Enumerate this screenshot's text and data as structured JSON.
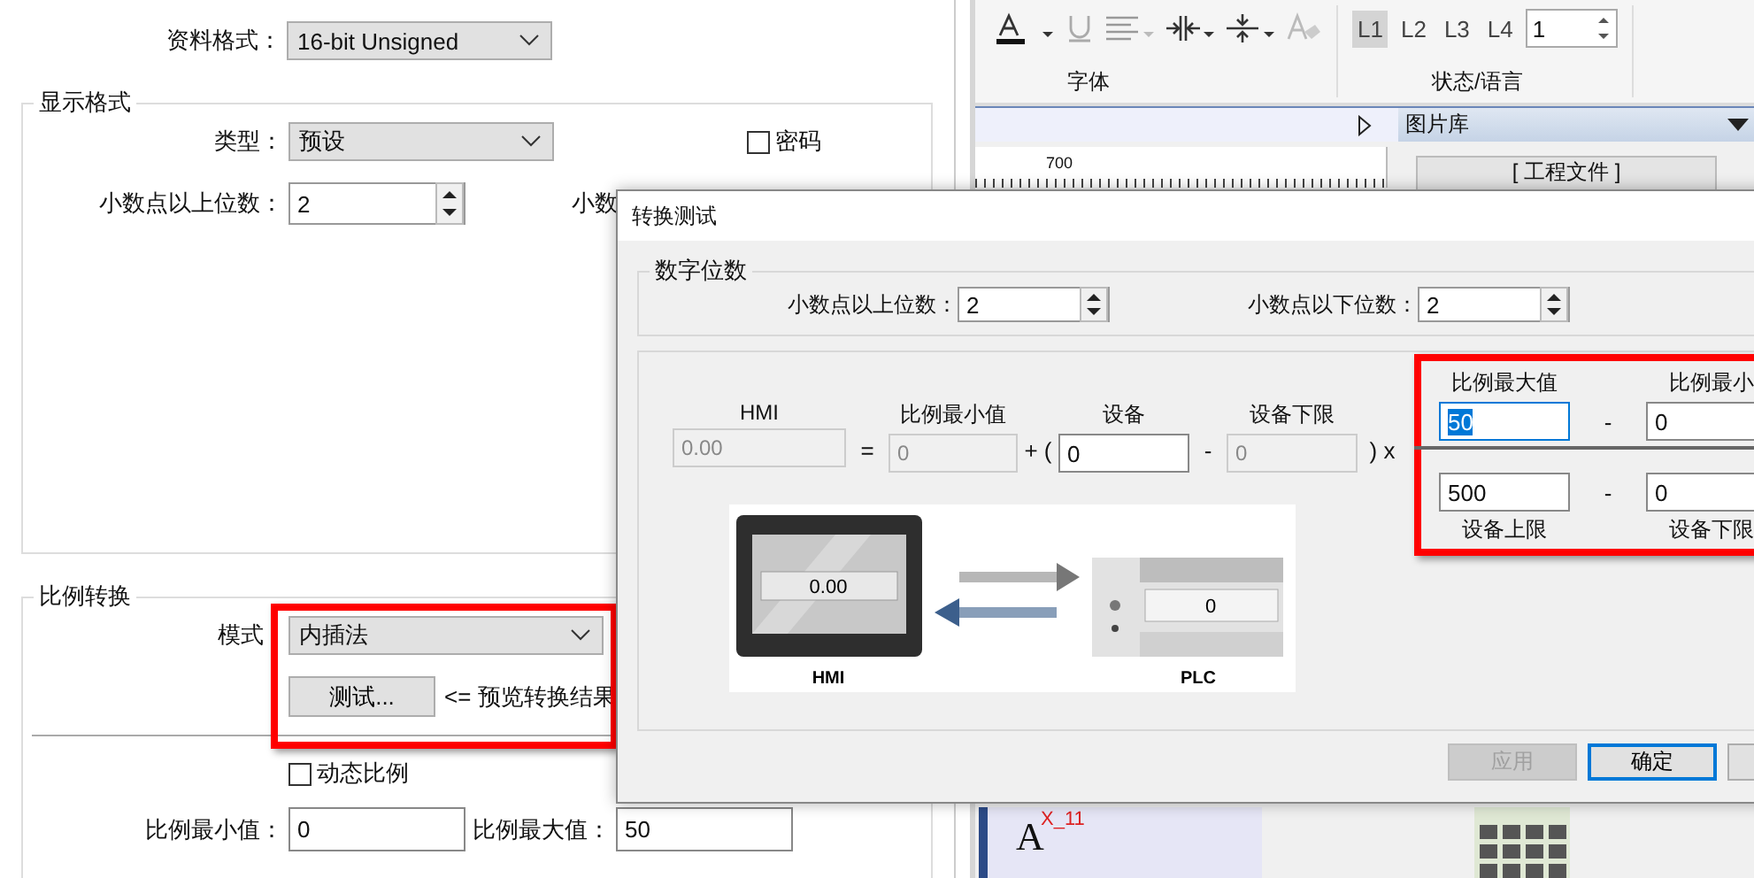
{
  "properties_panel": {
    "data_format": {
      "label": "资料格式：",
      "value": "16-bit Unsigned"
    },
    "display_format": {
      "title": "显示格式",
      "type": {
        "label": "类型：",
        "value": "预设"
      },
      "password": {
        "label": "密码",
        "checked": false
      },
      "digits_above": {
        "label": "小数点以上位数：",
        "value": "2"
      },
      "digits_below_label": "小数"
    },
    "scaling": {
      "title": "比例转换",
      "mode": {
        "label": "模式",
        "value": "内插法"
      },
      "test_button": "测试...",
      "test_hint": "<= 预览转换结果",
      "dynamic": {
        "label": "动态比例",
        "checked": false
      },
      "scale_min": {
        "label": "比例最小值：",
        "value": "0"
      },
      "scale_max": {
        "label": "比例最大值：",
        "value": "50"
      }
    }
  },
  "ribbon": {
    "levels": [
      {
        "label": "L1",
        "selected": true
      },
      {
        "label": "L2",
        "selected": false
      },
      {
        "label": "L3",
        "selected": false
      },
      {
        "label": "L4",
        "selected": false
      }
    ],
    "level_value": "1",
    "group_labels": [
      "字体",
      "状态/语言"
    ]
  },
  "workspace": {
    "ruler_mark": "700",
    "gallery": {
      "title": "图片库",
      "source": "[ 工程文件 ]"
    },
    "canvas_text": "A",
    "canvas_tag": "X_11"
  },
  "dialog": {
    "title": "转换测试",
    "digits": {
      "title": "数字位数",
      "above": {
        "label": "小数点以上位数：",
        "value": "2"
      },
      "below": {
        "label": "小数点以下位数：",
        "value": "2"
      }
    },
    "formula": {
      "hmi": {
        "label": "HMI",
        "value": "0.00"
      },
      "equals": "=",
      "scale_min": {
        "label": "比例最小值",
        "value": "0"
      },
      "open": "+ (",
      "device": {
        "label": "设备",
        "value": "0"
      },
      "minus": "-",
      "device_low": {
        "label": "设备下限",
        "value": "0"
      },
      "close": ") x",
      "fraction": {
        "top_left": {
          "label": "比例最大值",
          "value": "50",
          "selected": true
        },
        "top_minus": "-",
        "top_right": {
          "label": "比例最小",
          "value": "0"
        },
        "bottom_left": {
          "label": "设备上限",
          "value": "500"
        },
        "bottom_minus": "-",
        "bottom_right": {
          "label": "设备下限",
          "value": "0"
        }
      }
    },
    "illustration": {
      "hmi_value": "0.00",
      "hmi_label": "HMI",
      "plc_value": "0",
      "plc_label": "PLC"
    },
    "buttons": [
      {
        "label": "应用",
        "disabled": true,
        "default": false
      },
      {
        "label": "确定",
        "disabled": false,
        "default": true
      }
    ]
  }
}
